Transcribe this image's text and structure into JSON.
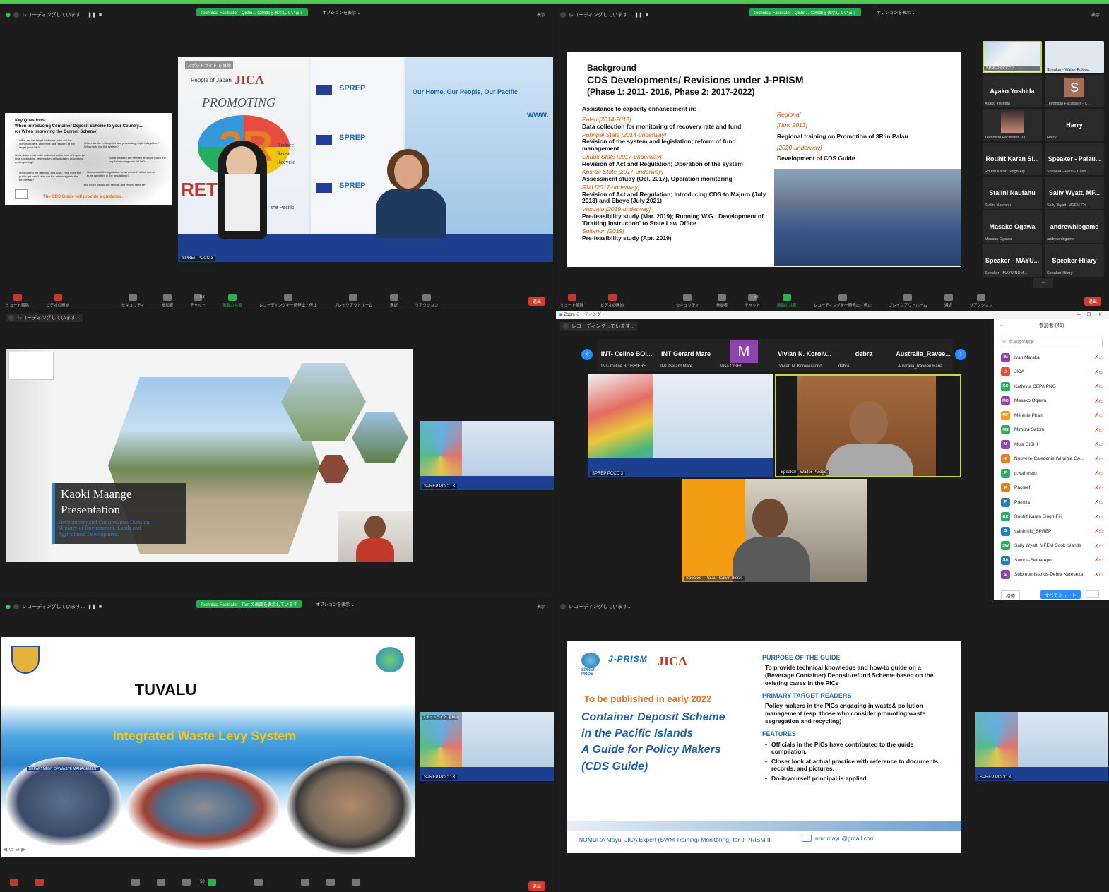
{
  "rec_label": "レコーディングしています...",
  "panel1": {
    "share_banner": "Technical Facilitator - Qistin... の画面を表示しています",
    "options": "オプションを表示 ⌄",
    "view": "表示",
    "spotlight": "スポットライト を解除",
    "cam_label": "SPREP PCCC 3",
    "slide": {
      "title1": "Key Questions:",
      "title2": "When Introducing Container Deposit Scheme to your Country....",
      "title3": "(or When Improving the Current Scheme)",
      "q1": "What are the target materials, who are the manufacturers, importers and retailers of the target products?",
      "q2": "Where do the redemption and processing might take place? Who might run the system?",
      "q3": "What data needs to be collected at the time of import (or local production), redemption, refund claim, processing, and exporting?",
      "q4": "What facilities are needed and how much the capital/ running cost will be?",
      "q5": "Who collect the deposits and how? How does the public get paid? How are the claims against the fund made?",
      "q6": "How should the legislation be structured? What needs to be specified in the regulations?",
      "q7": "How much should the deposit and refund rates be?",
      "footer": "The CDS Guide will provide a guidance."
    },
    "banner": {
      "jica": "JICA",
      "promoting": "PROMOTING",
      "big": "3R",
      "reduce": "Reduce",
      "reuse": "Reuse",
      "recycle": "Recycle",
      "return": "RETURN",
      "sprep": "SPREP",
      "pacific_heading": "Our Home, Our People, Our Pacific",
      "www": "www.",
      "the_pacific": "the Pacific",
      "people_of_japan": "People of Japan"
    },
    "toolbar": [
      "ミュート解除",
      "ビデオの開始",
      "セキュリティ",
      "参加者",
      "チャット",
      "画面の共有",
      "レコーディングを一時停止／停止",
      "ブレイクアウトルーム",
      "通訳",
      "リアクション"
    ],
    "participant_count": "53",
    "leave": "退出"
  },
  "panel2": {
    "share_banner": "Technical Facilitator - Qistin... の画面を表示しています",
    "options": "オプションを表示 ⌄",
    "view": "表示",
    "slide": {
      "title1": "Background",
      "title2": "CDS Developments/ Revisions under J-PRISM",
      "title3": "(Phase 1: 2011- 2016, Phase 2: 2017-2022)",
      "intro": "Assistance to capacity enhancement in:",
      "items": [
        {
          "place": "Palau [2014-2015]",
          "desc": "Data collection for monitoring of recovery rate and fund"
        },
        {
          "place": "Pohnpei State [2014-underway]",
          "desc": "Revision of the system and legislation; reform of fund management"
        },
        {
          "place": "Chuuk State [2017-underway]",
          "desc": "Revision of Act and Regulation; Operation of the system"
        },
        {
          "place": "Kosrae State [2017-underway]",
          "desc": "Assessment study (Oct. 2017), Operation monitoring"
        },
        {
          "place": "RMI [2017-underway]",
          "desc": "Revision of Act and Regulation; Introducing CDS to Majuro (July 2018) and Ebeye (July 2021)"
        },
        {
          "place": "Vanuatu [2019-underway]",
          "desc": "Pre-feasibility study (Mar. 2019); Running W.G.; Development of 'Drafting Instruction' to State Law Office"
        },
        {
          "place": "Solomon [2019]",
          "desc": "Pre-feasibility study (Apr. 2019)"
        }
      ],
      "regional": "Regional",
      "reg1_date": "[Nov. 2013]",
      "reg1_desc": "Regional training on Promotion of 3R in Palau",
      "reg2_date": "[2020-underway]",
      "reg2_desc": "Development of CDS Guide"
    },
    "gallery": [
      {
        "name": "",
        "sub": "SPREP PCCC 3"
      },
      {
        "name": "",
        "sub": "Speaker - Walter Pulogo"
      },
      {
        "name": "Ayako Yoshida",
        "sub": "Ayako Yoshida"
      },
      {
        "name": "S",
        "sub": "Technical Facilitator - T..."
      },
      {
        "name": "",
        "sub": "Technical Facilitator - Q..."
      },
      {
        "name": "Harry",
        "sub": "Harry"
      },
      {
        "name": "Rouhit Karan Si...",
        "sub": "Rouhit Karan Singh-Fiji"
      },
      {
        "name": "Speaker - Palau...",
        "sub": "Speaker - Palau- Calvi..."
      },
      {
        "name": "Stalini Naufahu",
        "sub": "Stalini Naufahu"
      },
      {
        "name": "Sally Wyatt, MF...",
        "sub": "Sally Wyatt, MFEM Co..."
      },
      {
        "name": "Masako Ogawa",
        "sub": "Masako Ogawa"
      },
      {
        "name": "andrewhibgame",
        "sub": "andrewhibgame"
      },
      {
        "name": "Speaker - MAYU...",
        "sub": "Speaker - MAYU NOM..."
      },
      {
        "name": "Speaker-Hilary",
        "sub": "Speaker-Hilary"
      }
    ],
    "participant_count": "52",
    "leave": "退出"
  },
  "panel3": {
    "slide_title1": "Kaoki Maange",
    "slide_title2": "Presentation",
    "slide_sub1": "Environment and Conservation Division,",
    "slide_sub2": "Ministry of Environment, Lands and",
    "slide_sub3": "Agricultural Development.",
    "cam_label": "SPREP PCCC 3"
  },
  "panel4": {
    "window_title": "Zoom ミーティング",
    "strip": [
      {
        "name": "INT- Celine BOI...",
        "sub": "INT- Celine BOISSIERE"
      },
      {
        "name": "INT Gerard Mare",
        "sub": "INT Gerard Mare"
      },
      {
        "name": "M",
        "sub": "Misa OISHI"
      },
      {
        "name": "Vivian N. Koroiv...",
        "sub": "Vivian N. Koroivulaono"
      },
      {
        "name": "debra",
        "sub": "debra"
      },
      {
        "name": "Australia_Ravee...",
        "sub": "Australia_Raveen Rana..."
      }
    ],
    "cam1": "SPREP PCCC 3",
    "cam2": "Speaker - Walter Pulogo",
    "cam3": "Speaker - Palau- Calvin Ikesiil",
    "participants_title": "参加者 (46)",
    "search_placeholder": "参加者の検索",
    "participants": [
      {
        "init": "IM",
        "name": "Ivan Maraka",
        "color": "#8e44ad"
      },
      {
        "init": "J",
        "name": "JICA",
        "color": "#e74c3c"
      },
      {
        "init": "KC",
        "name": "Kathrina CEPA PNG",
        "color": "#27ae60"
      },
      {
        "init": "MO",
        "name": "Masako Ogawa",
        "color": "#8e44ad"
      },
      {
        "init": "MP",
        "name": "Mélanie Pham",
        "color": "#f39c12"
      },
      {
        "init": "MS",
        "name": "Mimura Satoru",
        "color": "#27ae60"
      },
      {
        "init": "M",
        "name": "Misa OISHI",
        "color": "#8e44ad"
      },
      {
        "init": "N(",
        "name": "Nouvelle-Caledonie (Virginie GA...",
        "color": "#e67e22"
      },
      {
        "init": "P",
        "name": "p.wahmetu",
        "color": "#27ae60"
      },
      {
        "init": "P",
        "name": "Pacreef",
        "color": "#e67e22"
      },
      {
        "init": "P",
        "name": "Premila",
        "color": "#2980b9"
      },
      {
        "init": "RK",
        "name": "Rouhit Karan Singh-Fiji",
        "color": "#27ae60"
      },
      {
        "init": "S",
        "name": "sainimilib_SPREP",
        "color": "#2980b9"
      },
      {
        "init": "SW",
        "name": "Sally Wyatt, MFEM Cook Islands",
        "color": "#27ae60"
      },
      {
        "init": "SA",
        "name": "Samoa-Setoa Apo",
        "color": "#2980b9"
      },
      {
        "init": "SI",
        "name": "Solomon Islands-Debra Kereseka",
        "color": "#8e44ad"
      }
    ],
    "invite": "招待",
    "mute_all": "すべてミュート",
    "more": "..."
  },
  "panel5": {
    "share_banner": "Technical Facilitator - Tom の画面を表示しています",
    "options": "オプションを表示 ⌄",
    "view": "表示",
    "slide_title": "TUVALU",
    "slide_sub": "Integrated Waste Levy System",
    "sign_text": "DEPARTMENT OF WASTE MANAGEMENT",
    "cam_label": "SPREP PCCC 3",
    "participant_count": "50",
    "leave": "退出"
  },
  "panel6": {
    "slide": {
      "logo_sprep": "SPREP PROE",
      "logo_jprism": "J-PRISM",
      "logo_jica": "JICA",
      "published": "To be published in early 2022",
      "t1": "Container Deposit Scheme",
      "t2": "in the Pacific Islands",
      "t3": "A Guide for Policy Makers",
      "t4": "(CDS Guide)",
      "h1": "PURPOSE OF THE GUIDE",
      "p1": "To provide technical knowledge and how-to guide on a (Beverage Container) Deposit-refund Scheme based on the existing cases in the PICs",
      "h2": "PRIMARY TARGET READERS",
      "p2": "Policy makers in the PICs engaging in waste& pollution management (esp. those who consider promoting waste segregation and recycling)",
      "h3": "FEATURES",
      "f1": "Officials in the PICs have contributed to the guide compilation.",
      "f2": "Closer look at actual practice with reference to documents, records, and pictures.",
      "f3": "Do-it-yourself principal is applied.",
      "footer": "NOMURA Mayu, JICA Expert (SWM Training/ Monitoring)  for J-PRISM II",
      "email": "nmr.mayu@gmail.com"
    },
    "cam_label": "SPREP PCCC 3"
  }
}
